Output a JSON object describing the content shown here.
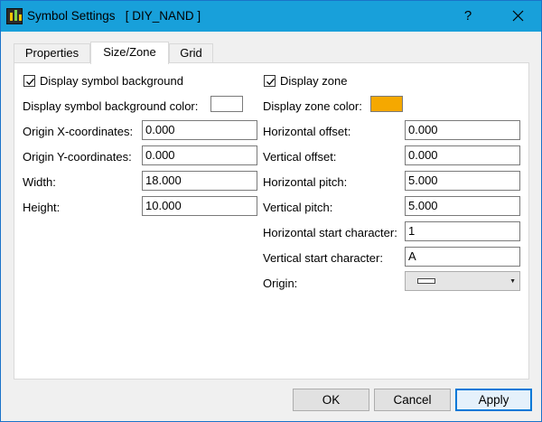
{
  "window": {
    "title": "Symbol Settings   [ DIY_NAND ]",
    "help_label": "?"
  },
  "tabs": [
    {
      "label": "Properties",
      "active": false
    },
    {
      "label": "Size/Zone",
      "active": true
    },
    {
      "label": "Grid",
      "active": false
    }
  ],
  "left": {
    "display_background": {
      "label": "Display symbol background",
      "checked": true
    },
    "background_color": {
      "label": "Display symbol background color:",
      "color": "#ffffff"
    },
    "origin_x": {
      "label": "Origin X-coordinates:",
      "value": "0.000"
    },
    "origin_y": {
      "label": "Origin Y-coordinates:",
      "value": "0.000"
    },
    "width": {
      "label": "Width:",
      "value": "18.000"
    },
    "height": {
      "label": "Height:",
      "value": "10.000"
    }
  },
  "right": {
    "display_zone": {
      "label": "Display zone",
      "checked": true
    },
    "zone_color": {
      "label": "Display zone color:",
      "color": "#f5a800"
    },
    "h_offset": {
      "label": "Horizontal offset:",
      "value": "0.000"
    },
    "v_offset": {
      "label": "Vertical offset:",
      "value": "0.000"
    },
    "h_pitch": {
      "label": "Horizontal pitch:",
      "value": "5.000"
    },
    "v_pitch": {
      "label": "Vertical pitch:",
      "value": "5.000"
    },
    "h_start": {
      "label": "Horizontal start character:",
      "value": "1"
    },
    "v_start": {
      "label": "Vertical start character:",
      "value": "A"
    },
    "origin": {
      "label": "Origin:"
    }
  },
  "buttons": {
    "ok": "OK",
    "cancel": "Cancel",
    "apply": "Apply"
  },
  "icons": {
    "app": "app-logo-icon",
    "close": "close-icon",
    "check": "checkmark-icon",
    "dropdown": "chevron-down-icon"
  }
}
